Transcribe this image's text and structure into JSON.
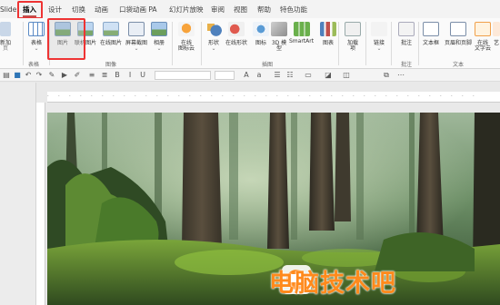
{
  "tabs": [
    "Slide",
    "插入",
    "设计",
    "切换",
    "动画",
    "口袋动画 PA",
    "幻灯片放映",
    "审阅",
    "视图",
    "帮助",
    "特色功能"
  ],
  "ribbon": {
    "left_partial": [
      "新加",
      "页"
    ],
    "table": "表格",
    "picture": "图片",
    "screen_picture": "联机图片",
    "online_picture": "在线图片",
    "screenshot": "屏幕截图",
    "album": "相册",
    "online_icon_1": "在线",
    "online_icon_2": "图标云",
    "shapes": "形状",
    "online_shapes": "在线形状",
    "icons": "图标",
    "model_3d_1": "3D 模",
    "model_3d_2": "型",
    "smartart": "SmartArt",
    "chart": "图表",
    "addin_1": "加载",
    "addin_2": "项",
    "link": "链接",
    "action": "动作",
    "comment": "批注",
    "textbox": "文本框",
    "header_footer": "页眉和页脚",
    "online_text_1": "在线",
    "online_text_2": "文字云",
    "art": "艺",
    "groups": {
      "table": "表格",
      "images": "图像",
      "illustrations": "插图",
      "comment": "批注",
      "text": "文本"
    }
  },
  "slide_image": {
    "watermark_text": "电脑技术吧"
  },
  "colors": {
    "accent_red": "#e33333",
    "tab_underline": "#c0504d",
    "watermark_orange": "#ff8a1c"
  }
}
